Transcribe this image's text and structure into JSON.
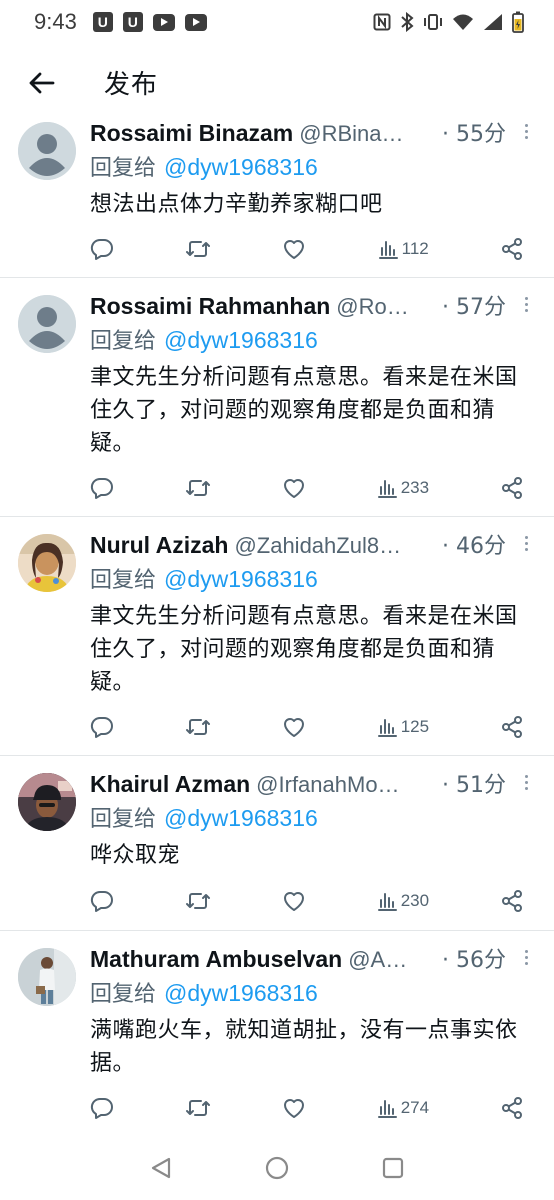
{
  "status_bar": {
    "time": "9:43",
    "notif_badges": [
      "U",
      "U"
    ],
    "icons": [
      "youtube-icon",
      "youtube-icon",
      "nfc-icon",
      "bluetooth-icon",
      "vibrate-icon",
      "wifi-icon",
      "signal-icon",
      "battery-charging-icon"
    ]
  },
  "header": {
    "title": "发布",
    "back_icon": "arrow-left-icon"
  },
  "replies": [
    {
      "name": "Rossaimi Binazam",
      "handle": "@RBina…",
      "time": "· 55分",
      "replying_label": "回复给",
      "replying_to": "@dyw1968316",
      "text": "想法出点体力辛勤养家糊口吧",
      "views": "112",
      "avatar": "default"
    },
    {
      "name": "Rossaimi Rahmanhan",
      "handle": "@Ro…",
      "time": "· 57分",
      "replying_label": "回复给",
      "replying_to": "@dyw1968316",
      "text": "聿文先生分析问题有点意思。看来是在米国住久了，对问题的观察角度都是负面和猜疑。",
      "views": "233",
      "avatar": "default"
    },
    {
      "name": "Nurul Azizah",
      "handle": "@ZahidahZul8…",
      "time": "· 46分",
      "replying_label": "回复给",
      "replying_to": "@dyw1968316",
      "text": "聿文先生分析问题有点意思。看来是在米国住久了，对问题的观察角度都是负面和猜疑。",
      "views": "125",
      "avatar": "photo-woman"
    },
    {
      "name": "Khairul Azman",
      "handle": "@IrfanahMo…",
      "time": "· 51分",
      "replying_label": "回复给",
      "replying_to": "@dyw1968316",
      "text": "哗众取宠",
      "views": "230",
      "avatar": "photo-man-cap"
    },
    {
      "name": "Mathuram Ambuselvan",
      "handle": "@A…",
      "time": "· 56分",
      "replying_label": "回复给",
      "replying_to": "@dyw1968316",
      "text": "满嘴跑火车，就知道胡扯，没有一点事实依据。",
      "views": "274",
      "avatar": "photo-man-standing"
    }
  ],
  "colors": {
    "accent": "#1d9bf0",
    "secondary_text": "#536471",
    "primary_text": "#0f1419",
    "divider": "#e3e6e8"
  },
  "nav_bar": {
    "icons": [
      "back-triangle-icon",
      "home-circle-icon",
      "recents-square-icon"
    ]
  }
}
